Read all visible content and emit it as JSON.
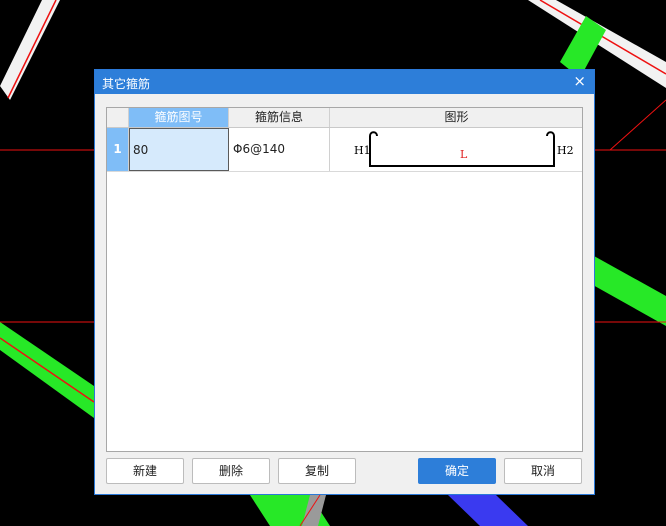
{
  "dialog": {
    "title": "其它箍筋",
    "close_glyph": "×"
  },
  "grid": {
    "headers": [
      "箍筋图号",
      "箍筋信息",
      "图形"
    ],
    "rows": [
      {
        "index": "1",
        "figure_no": "80",
        "info": "Φ6@140",
        "shape": {
          "left_label": "H1",
          "mid_label": "L",
          "right_label": "H2"
        }
      }
    ]
  },
  "buttons": {
    "new": "新建",
    "delete": "删除",
    "copy": "复制",
    "ok": "确定",
    "cancel": "取消"
  },
  "colors": {
    "titlebar": "#2d7ed9",
    "selected_header": "#7fbdf7",
    "selected_cell": "#d6eafc",
    "shape_label_mid": "#e02020"
  }
}
